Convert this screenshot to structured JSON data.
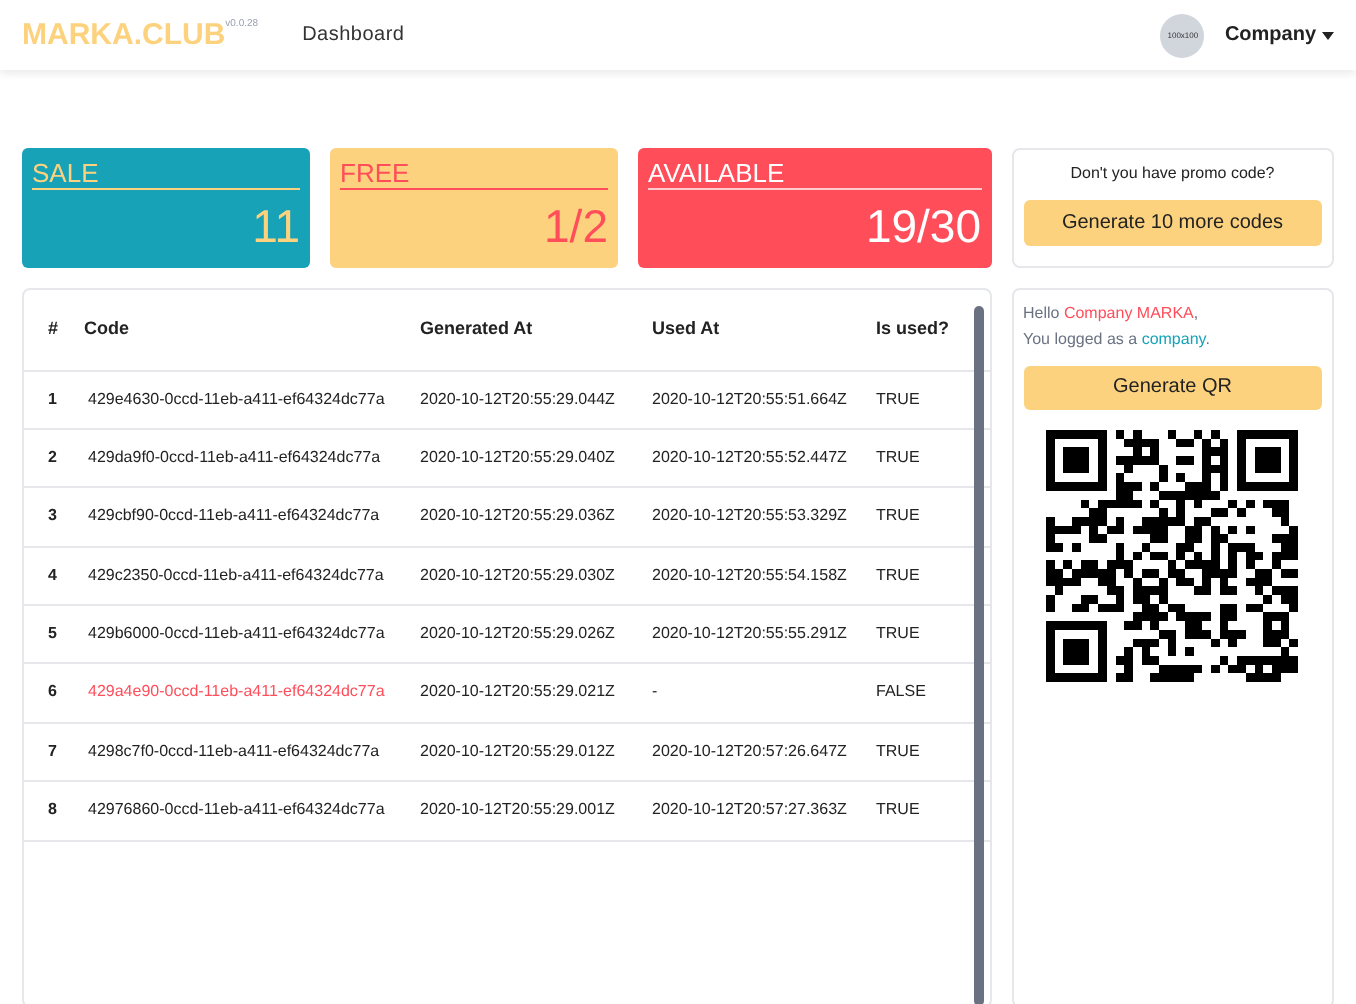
{
  "navbar": {
    "logo": "MARKA.CLUB",
    "version": "v0.0.28",
    "links": [
      {
        "label": "Dashboard"
      }
    ],
    "avatar": "100x100",
    "user_menu": "Company"
  },
  "stats": [
    {
      "kind": "sale",
      "title": "SALE",
      "value": "11"
    },
    {
      "kind": "free",
      "title": "FREE",
      "value": "1/2"
    },
    {
      "kind": "available",
      "title": "AVAILABLE",
      "value": "19/30"
    }
  ],
  "promo": {
    "question": "Don't you have promo code?",
    "button": "Generate 10 more codes"
  },
  "table": {
    "columns": [
      "#",
      "Code",
      "Generated At",
      "Used At",
      "Is used?"
    ],
    "rows": [
      {
        "number": "1",
        "code": "429e4630-0ccd-11eb-a411-ef64324dc77a",
        "generated_at": "2020-10-12T20:55:29.044Z",
        "used_at": "2020-10-12T20:55:51.664Z",
        "is_used": "TRUE",
        "highlighted": false
      },
      {
        "number": "2",
        "code": "429da9f0-0ccd-11eb-a411-ef64324dc77a",
        "generated_at": "2020-10-12T20:55:29.040Z",
        "used_at": "2020-10-12T20:55:52.447Z",
        "is_used": "TRUE",
        "highlighted": false
      },
      {
        "number": "3",
        "code": "429cbf90-0ccd-11eb-a411-ef64324dc77a",
        "generated_at": "2020-10-12T20:55:29.036Z",
        "used_at": "2020-10-12T20:55:53.329Z",
        "is_used": "TRUE",
        "highlighted": false
      },
      {
        "number": "4",
        "code": "429c2350-0ccd-11eb-a411-ef64324dc77a",
        "generated_at": "2020-10-12T20:55:29.030Z",
        "used_at": "2020-10-12T20:55:54.158Z",
        "is_used": "TRUE",
        "highlighted": false
      },
      {
        "number": "5",
        "code": "429b6000-0ccd-11eb-a411-ef64324dc77a",
        "generated_at": "2020-10-12T20:55:29.026Z",
        "used_at": "2020-10-12T20:55:55.291Z",
        "is_used": "TRUE",
        "highlighted": false
      },
      {
        "number": "6",
        "code": "429a4e90-0ccd-11eb-a411-ef64324dc77a",
        "generated_at": "2020-10-12T20:55:29.021Z",
        "used_at": "-",
        "is_used": "FALSE",
        "highlighted": true
      },
      {
        "number": "7",
        "code": "4298c7f0-0ccd-11eb-a411-ef64324dc77a",
        "generated_at": "2020-10-12T20:55:29.012Z",
        "used_at": "2020-10-12T20:57:26.647Z",
        "is_used": "TRUE",
        "highlighted": false
      },
      {
        "number": "8",
        "code": "42976860-0ccd-11eb-a411-ef64324dc77a",
        "generated_at": "2020-10-12T20:55:29.001Z",
        "used_at": "2020-10-12T20:57:27.363Z",
        "is_used": "TRUE",
        "highlighted": false
      }
    ]
  },
  "profile": {
    "greeting": "Hello",
    "name": "Company MARKA",
    "name_suffix": ",",
    "line2": "You logged as a",
    "role": "company",
    "end": ".",
    "button": "Generate QR"
  }
}
